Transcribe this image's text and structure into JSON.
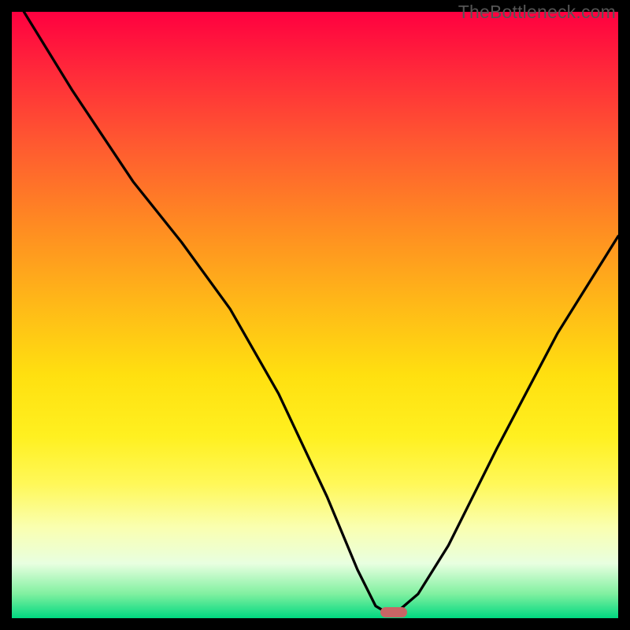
{
  "watermark": "TheBottleneck.com",
  "colors": {
    "frame": "#000000",
    "curve_stroke": "#000000",
    "marker_fill": "#c96565"
  },
  "chart_data": {
    "type": "line",
    "title": "",
    "xlabel": "",
    "ylabel": "",
    "xlim": [
      0,
      100
    ],
    "ylim": [
      0,
      100
    ],
    "grid": false,
    "series": [
      {
        "name": "bottleneck-curve",
        "x": [
          2,
          10,
          20,
          28,
          36,
          44,
          52,
          57,
          60,
          61.7,
          63.5,
          67,
          72,
          80,
          90,
          100
        ],
        "values": [
          100,
          87,
          72,
          62,
          51,
          37,
          20,
          8,
          2,
          1,
          1,
          4,
          12,
          28,
          47,
          63
        ]
      }
    ],
    "marker": {
      "x": 63,
      "y": 1,
      "shape": "pill"
    }
  }
}
